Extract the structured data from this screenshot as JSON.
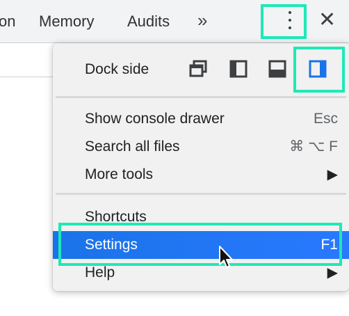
{
  "tabs": [
    {
      "label": "on"
    },
    {
      "label": "Memory"
    },
    {
      "label": "Audits"
    }
  ],
  "toolbar": {
    "overflow_label": "»",
    "menu_icon": "vertical-ellipsis-icon",
    "close_label": "✕"
  },
  "menu": {
    "dock_side_label": "Dock side",
    "dock_options": [
      {
        "name": "undock-icon",
        "selected": false
      },
      {
        "name": "dock-left-icon",
        "selected": false
      },
      {
        "name": "dock-bottom-icon",
        "selected": false
      },
      {
        "name": "dock-right-icon",
        "selected": true
      }
    ],
    "items": [
      {
        "label": "Show console drawer",
        "shortcut": "Esc"
      },
      {
        "label": "Search all files",
        "shortcut": "⌘ ⌥ F"
      },
      {
        "label": "More tools",
        "arrow": "▶"
      },
      {
        "label": "Shortcuts"
      },
      {
        "label": "Settings",
        "shortcut": "F1",
        "highlighted": true
      },
      {
        "label": "Help",
        "arrow": "▶"
      }
    ]
  },
  "colors": {
    "highlight_outline": "#1de9b6",
    "selected_row": "#1a73e8",
    "dock_selected": "#1a73e8"
  }
}
